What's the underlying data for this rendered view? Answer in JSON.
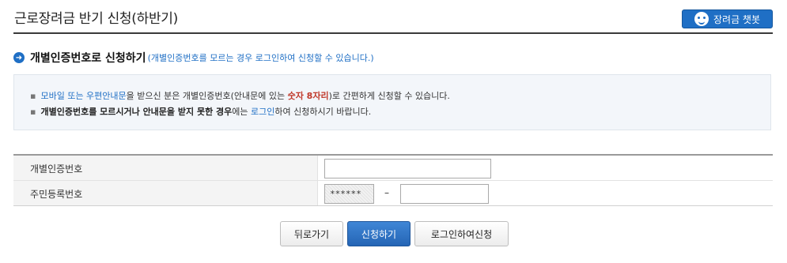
{
  "page": {
    "title": "근로장려금 반기 신청(하반기)"
  },
  "chatbot": {
    "label": "장려금 챗봇",
    "icon": "chatbot-face-icon"
  },
  "section": {
    "title": "개별인증번호로 신청하기",
    "subtitle": "(개별인증번호를 모르는 경우 로그인하여 신청할 수 있습니다.)",
    "icon": "arrow-right-circle-icon"
  },
  "info": {
    "line1": {
      "part1": "모바일 또는 우편안내문",
      "part2": "을 받으신 분은 개별인증번호(안내문에 있는 ",
      "part3": "숫자 8자리",
      "part4": ")로 간편하게 신청할 수 있습니다."
    },
    "line2": {
      "part1": "개별인증번호를 모르시거나 안내문을 받지 못한 경우",
      "part2": "에는 ",
      "part3": "로그인",
      "part4": "하여 신청하시기 바랍니다."
    }
  },
  "form": {
    "auth_label": "개별인증번호",
    "auth_value": "",
    "rrn_label": "주민등록번호",
    "rrn_front_masked": "******",
    "rrn_separator": "–",
    "rrn_back_value": ""
  },
  "buttons": {
    "back": "뒤로가기",
    "apply": "신청하기",
    "login_apply": "로그인하여신청"
  },
  "colors": {
    "accent": "#1f6fc5",
    "highlight": "#c0392b"
  }
}
